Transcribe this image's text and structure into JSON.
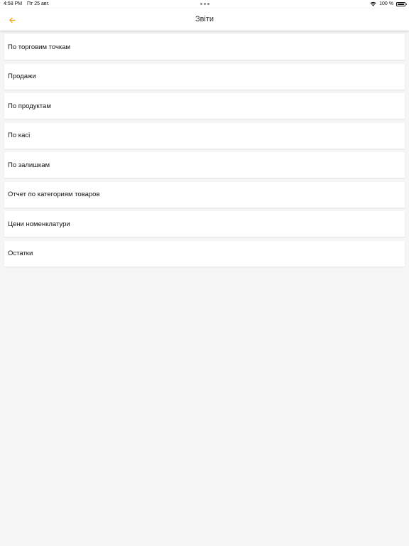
{
  "status_bar": {
    "time": "4:58 PM",
    "date": "Пт 25 авг.",
    "battery": "100 %"
  },
  "nav": {
    "title": "Звіти",
    "back_icon": "arrow-left-icon",
    "accent_color": "#f0a500"
  },
  "reports": {
    "items": [
      {
        "label": "По торговим точкам"
      },
      {
        "label": "Продажи"
      },
      {
        "label": "По продуктам"
      },
      {
        "label": "По касі"
      },
      {
        "label": "По залишкам"
      },
      {
        "label": "Отчет по категориям товаров"
      },
      {
        "label": "Цени номенклатури"
      },
      {
        "label": "Остатки"
      }
    ]
  }
}
